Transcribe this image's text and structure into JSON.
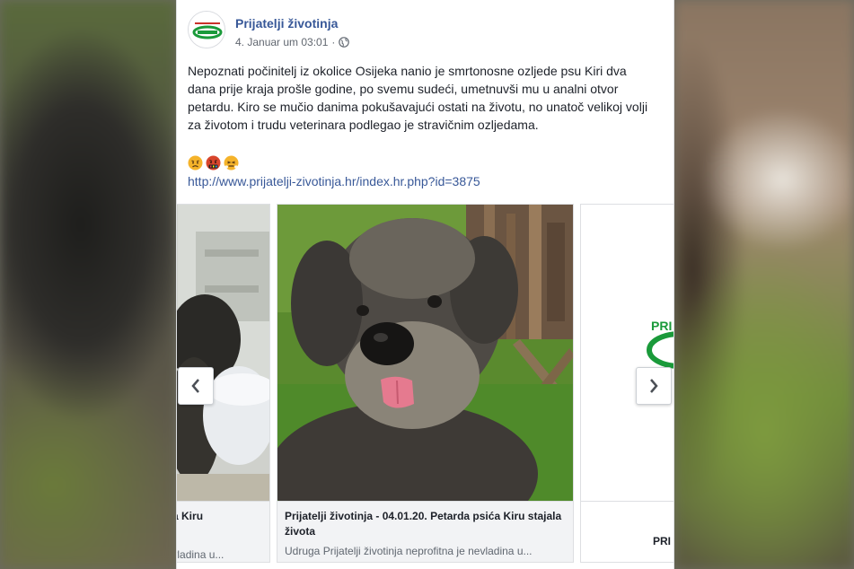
{
  "post": {
    "page_name": "Prijatelji životinja",
    "timestamp": "4. Januar um 03:01",
    "separator": "·",
    "text": "Nepoznati počinitelj iz okolice Osijeka nanio je smrtonosne ozljede psu Kiri dva dana prije kraja prošle godine, po svemu sudeći, umetnuvši mu u analni otvor petardu. Kiro se mučio danima pokušavajući ostati na životu, no unatoč velikoj volji za životom i trudu veterinara podlegao je stravičnim ozljedama.",
    "emojis": [
      "angry-face-icon",
      "cursing-face-icon",
      "frustrated-face-icon"
    ],
    "link": "http://www.prijatelji-zivotinja.hr/index.hr.php?id=3875"
  },
  "carousel": {
    "cards": [
      {
        "title": "psića Kiru",
        "subtitle": "e nevladina u..."
      },
      {
        "title": "Prijatelji životinja - 04.01.20. Petarda psića Kiru stajala života",
        "subtitle": "Udruga Prijatelji životinja neprofitna je nevladina u..."
      },
      {
        "title": "PRI"
      }
    ],
    "prev_icon": "chevron-left-icon",
    "next_icon": "chevron-right-icon"
  },
  "colors": {
    "link_blue": "#385898",
    "logo_green": "#1a9a3a",
    "caption_bg": "#f2f3f5"
  }
}
